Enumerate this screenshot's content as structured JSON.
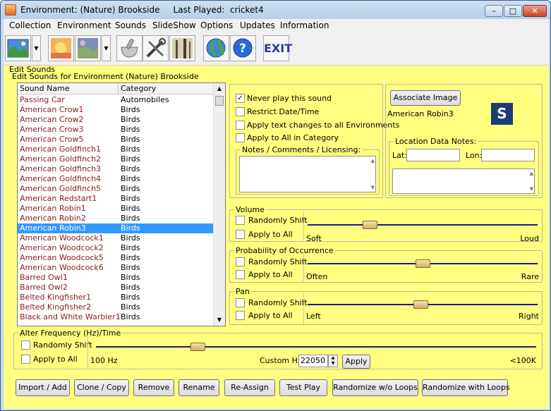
{
  "window": {
    "title": "Environment: (Nature) Brookside     Last Played:  cricket4",
    "buttons": {
      "minimize": "–",
      "maximize": "□",
      "close": "✕"
    }
  },
  "menu": [
    "Collection",
    "Environment",
    "Sounds",
    "SlideShow",
    "Options",
    "Updates",
    "Information"
  ],
  "toolbar": {
    "icons": [
      "landscape-picture-icon",
      "sunset-picture-icon",
      "painting-icon",
      "mortar-pestle-icon",
      "tools-icon",
      "forest-picture-icon",
      "globe-icon",
      "help-icon"
    ],
    "exit_label": "EXIT"
  },
  "edit_sounds": {
    "outer_label": "Edit Sounds",
    "inner_label": "Edit Sounds for Environment (Nature) Brookside",
    "list": {
      "headers": [
        "Sound Name",
        "Category"
      ],
      "rows": [
        {
          "name": "Passing Car",
          "category": "Automobiles"
        },
        {
          "name": "American Crow1",
          "category": "Birds"
        },
        {
          "name": "American Crow2",
          "category": "Birds"
        },
        {
          "name": "American Crow3",
          "category": "Birds"
        },
        {
          "name": "American Crow5",
          "category": "Birds"
        },
        {
          "name": "American Goldfinch1",
          "category": "Birds"
        },
        {
          "name": "American Goldfinch2",
          "category": "Birds"
        },
        {
          "name": "American Goldfinch3",
          "category": "Birds"
        },
        {
          "name": "American Goldfinch4",
          "category": "Birds"
        },
        {
          "name": "American Goldfinch5",
          "category": "Birds"
        },
        {
          "name": "American Redstart1",
          "category": "Birds"
        },
        {
          "name": "American Robin1",
          "category": "Birds"
        },
        {
          "name": "American Robin2",
          "category": "Birds"
        },
        {
          "name": "American Robin3",
          "category": "Birds"
        },
        {
          "name": "American Woodcock1",
          "category": "Birds"
        },
        {
          "name": "American Woodcock2",
          "category": "Birds"
        },
        {
          "name": "American Woodcock5",
          "category": "Birds"
        },
        {
          "name": "American Woodcock6",
          "category": "Birds"
        },
        {
          "name": "Barred Owl1",
          "category": "Birds"
        },
        {
          "name": "Barred Owl2",
          "category": "Birds"
        },
        {
          "name": "Belted Kingfisher1",
          "category": "Birds"
        },
        {
          "name": "Belted Kingfisher2",
          "category": "Birds"
        },
        {
          "name": "Black and White Warbler1",
          "category": "Birds"
        }
      ],
      "selected_index": 13
    }
  },
  "options": {
    "never_play": {
      "label": "Never play this sound",
      "checked": true
    },
    "restrict_date": {
      "label": "Restrict Date/Time",
      "checked": false
    },
    "apply_text": {
      "label": "Apply text changes to all Environments",
      "checked": false
    },
    "apply_category": {
      "label": "Apply to All in Category",
      "checked": false
    },
    "notes_label": "Notes / Comments / Licensing:"
  },
  "image_panel": {
    "associate_button": "Associate Image",
    "image_name": "American Robin3",
    "badge": "S",
    "location_label": "Location Data Notes:",
    "lat_label": "Lat:",
    "lon_label": "Lon:",
    "lat_value": "",
    "lon_value": ""
  },
  "volume": {
    "label": "Volume",
    "randomly_shift": "Randomly Shift",
    "apply_all": "Apply to All",
    "min_label": "Soft",
    "max_label": "Loud",
    "level": 0.27
  },
  "probability": {
    "label": "Probability of Occurrence",
    "randomly_shift": "Randomly Shift",
    "apply_all": "Apply to All",
    "min_label": "Often",
    "max_label": "Rare",
    "level": 0.5
  },
  "pan": {
    "label": "Pan",
    "randomly_shift": "Randomly Shift",
    "apply_all": "Apply to All",
    "min_label": "Left",
    "max_label": "Right",
    "level": 0.49
  },
  "frequency": {
    "label": "Alter Frequency (Hz)/Time",
    "randomly_shift": "Randomly Shift",
    "apply_all": "Apply to All",
    "min_label": "100 Hz",
    "max_label": "<100K",
    "custom_label": "Custom Hz",
    "custom_value": "22050",
    "apply_button": "Apply",
    "level": 0.23
  },
  "bottom_buttons": [
    "Import / Add",
    "Clone / Copy",
    "Remove",
    "Rename",
    "Re-Assign",
    "Test Play",
    "Randomize w/o Loops",
    "Randomize with Loops"
  ],
  "colors": {
    "panel": "#ffff80",
    "list_name": "#8b1a1a",
    "selection": "#3399ff",
    "slider_track": "#1a1a8c",
    "badge_bg": "#1e3a78"
  }
}
